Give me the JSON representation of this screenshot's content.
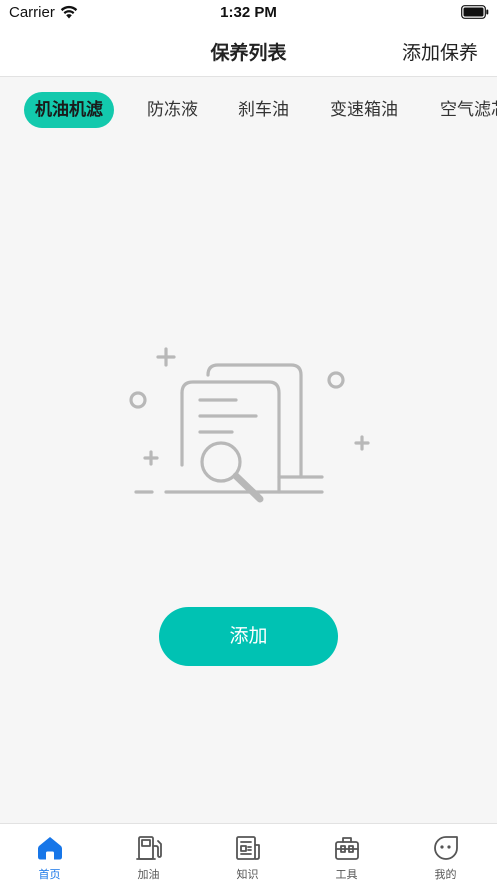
{
  "status_bar": {
    "carrier": "Carrier",
    "time": "1:32 PM"
  },
  "nav": {
    "title": "保养列表",
    "action": "添加保养"
  },
  "tabs": [
    {
      "label": "机油机滤",
      "active": true
    },
    {
      "label": "防冻液",
      "active": false
    },
    {
      "label": "刹车油",
      "active": false
    },
    {
      "label": "变速箱油",
      "active": false
    },
    {
      "label": "空气滤芯",
      "active": false
    }
  ],
  "empty_state": {
    "add_label": "添加"
  },
  "tab_bar": [
    {
      "label": "首页",
      "icon": "home-icon",
      "active": true
    },
    {
      "label": "加油",
      "icon": "fuel-pump-icon",
      "active": false
    },
    {
      "label": "知识",
      "icon": "newspaper-icon",
      "active": false
    },
    {
      "label": "工具",
      "icon": "toolbox-icon",
      "active": false
    },
    {
      "label": "我的",
      "icon": "profile-face-icon",
      "active": false
    }
  ],
  "colors": {
    "accent_tab": "#13c9ad",
    "button": "#00c2b3",
    "tab_bar_active": "#1776e8",
    "background": "#f6f6f6"
  }
}
